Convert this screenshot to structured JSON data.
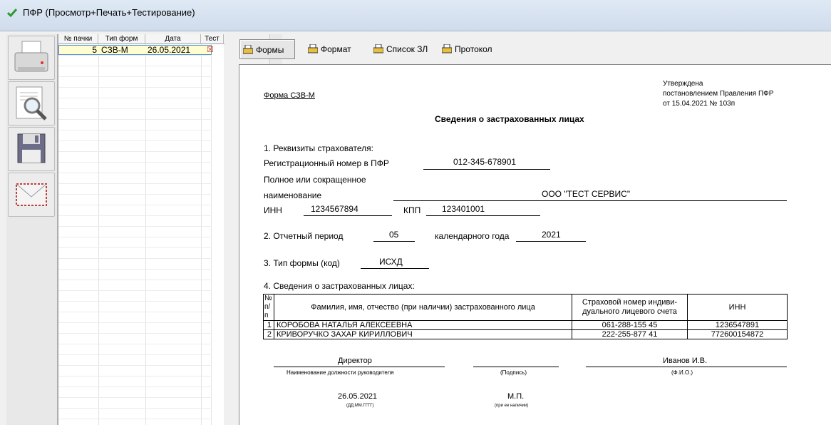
{
  "window": {
    "title": "ПФР (Просмотр+Печать+Тестирование)"
  },
  "toolbar": {
    "buttons": [
      {
        "icon": "printer-icon"
      },
      {
        "icon": "preview-icon"
      },
      {
        "icon": "save-icon"
      },
      {
        "icon": "envelope-icon"
      }
    ]
  },
  "grid": {
    "headers": [
      "№ пачки",
      "Тип форм",
      "Дата",
      "Тест"
    ],
    "rows": [
      {
        "pack": "5",
        "form": "СЗВ-М",
        "date": "26.05.2021",
        "test": "☒"
      }
    ]
  },
  "tabs": [
    {
      "label": "Формы",
      "active": true
    },
    {
      "label": "Формат",
      "active": false
    },
    {
      "label": "Список ЗЛ",
      "active": false
    },
    {
      "label": "Протокол",
      "active": false
    }
  ],
  "doc": {
    "approved_1": "Утверждена",
    "approved_2": "постановлением Правления ПФР",
    "approved_3": "от 15.04.2021 № 103п",
    "form_name": "Форма СЗВ-М",
    "title": "Сведения о застрахованных лицах",
    "s1": "1. Реквизиты страхователя:",
    "reg_label": "Регистрационный номер в ПФР",
    "reg_value": "012-345-678901",
    "name_label1": "Полное или сокращенное",
    "name_label2": "наименование",
    "name_value": "ООО \"ТЕСТ СЕРВИС\"",
    "inn_label": "ИНН",
    "inn_value": "1234567894",
    "kpp_label": "КПП",
    "kpp_value": "123401001",
    "period_label": "2. Отчетный период",
    "period_value": "05",
    "year_label": "календарного года",
    "year_value": "2021",
    "type_label": "3. Тип формы (код)",
    "type_value": "ИСХД",
    "s4": "4. Сведения о застрахованных лицах:",
    "table_headers": {
      "num1": "№",
      "num2": "п/п",
      "fio": "Фамилия, имя, отчество (при наличии) застрахованного лица",
      "snils1": "Страховой номер индиви-",
      "snils2": "дуального лицевого счета",
      "inn": "ИНН"
    },
    "people": [
      {
        "n": "1",
        "fio": "КОРОБОВА НАТАЛЬЯ АЛЕКСЕЕВНА",
        "snils": "061-288-155 45",
        "inn": "1236547891"
      },
      {
        "n": "2",
        "fio": "КРИВОРУЧКО ЗАХАР КИРИЛЛОВИЧ",
        "snils": "222-255-877 41",
        "inn": "772600154872"
      }
    ],
    "position_value": "Директор",
    "position_caption": "Наименование должности руководителя",
    "sign_caption": "(Подпись)",
    "fio_value": "Иванов И.В.",
    "fio_caption": "(Ф.И.О.)",
    "date_value": "26.05.2021",
    "date_caption": "(ДД.ММ.ГГГГ)",
    "mp": "М.П.",
    "mp_caption": "(при ее наличии)"
  }
}
